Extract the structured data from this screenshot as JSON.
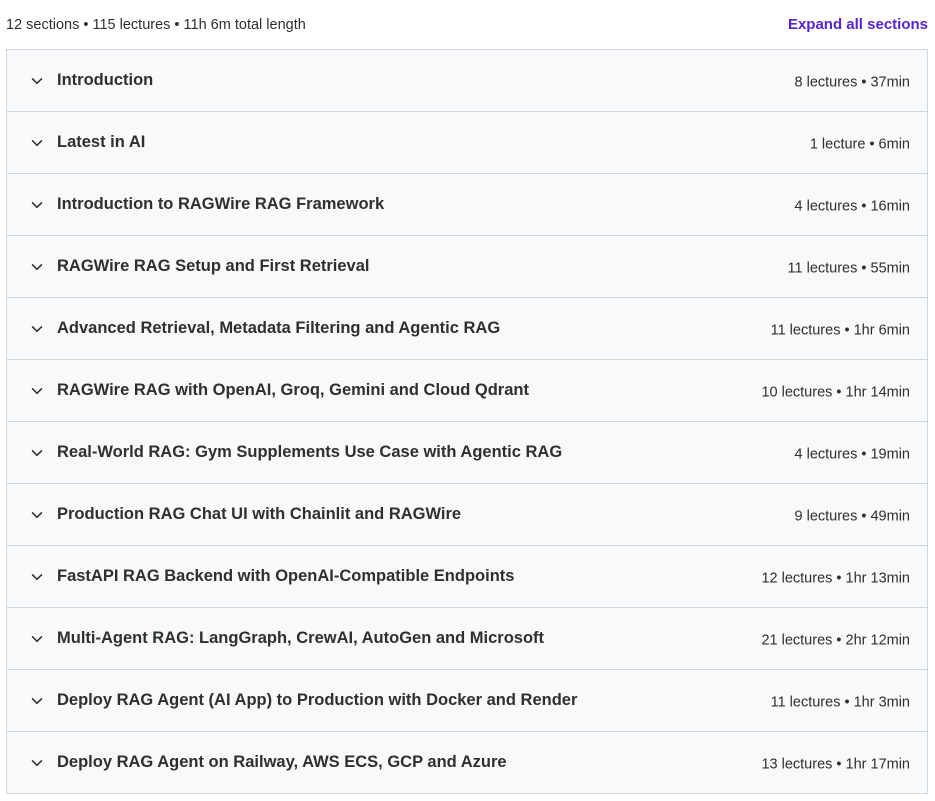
{
  "summary": {
    "text": "12 sections • 115 lectures • 11h 6m total length",
    "expand_label": "Expand all sections"
  },
  "colors": {
    "accent": "#5624d0",
    "row_bg": "#f7f9fa",
    "border": "#d1d7dc",
    "text": "#2d2f31"
  },
  "icons": {
    "row_toggle": "chevron-down-icon"
  },
  "sections": [
    {
      "title": "Introduction",
      "meta": "8 lectures • 37min"
    },
    {
      "title": "Latest in AI",
      "meta": "1 lecture • 6min"
    },
    {
      "title": "Introduction to RAGWire RAG Framework",
      "meta": "4 lectures • 16min"
    },
    {
      "title": "RAGWire RAG Setup and First Retrieval",
      "meta": "11 lectures • 55min"
    },
    {
      "title": "Advanced Retrieval, Metadata Filtering and Agentic RAG",
      "meta": "11 lectures • 1hr 6min"
    },
    {
      "title": "RAGWire RAG with OpenAI, Groq, Gemini and Cloud Qdrant",
      "meta": "10 lectures • 1hr 14min"
    },
    {
      "title": "Real-World RAG: Gym Supplements Use Case with Agentic RAG",
      "meta": "4 lectures • 19min"
    },
    {
      "title": "Production RAG Chat UI with Chainlit and RAGWire",
      "meta": "9 lectures • 49min"
    },
    {
      "title": "FastAPI RAG Backend with OpenAI-Compatible Endpoints",
      "meta": "12 lectures • 1hr 13min"
    },
    {
      "title": "Multi-Agent RAG: LangGraph, CrewAI, AutoGen and Microsoft",
      "meta": "21 lectures • 2hr 12min"
    },
    {
      "title": "Deploy RAG Agent (AI App) to Production with Docker and Render",
      "meta": "11 lectures • 1hr 3min"
    },
    {
      "title": "Deploy RAG Agent on Railway, AWS ECS, GCP and Azure",
      "meta": "13 lectures • 1hr 17min"
    }
  ]
}
